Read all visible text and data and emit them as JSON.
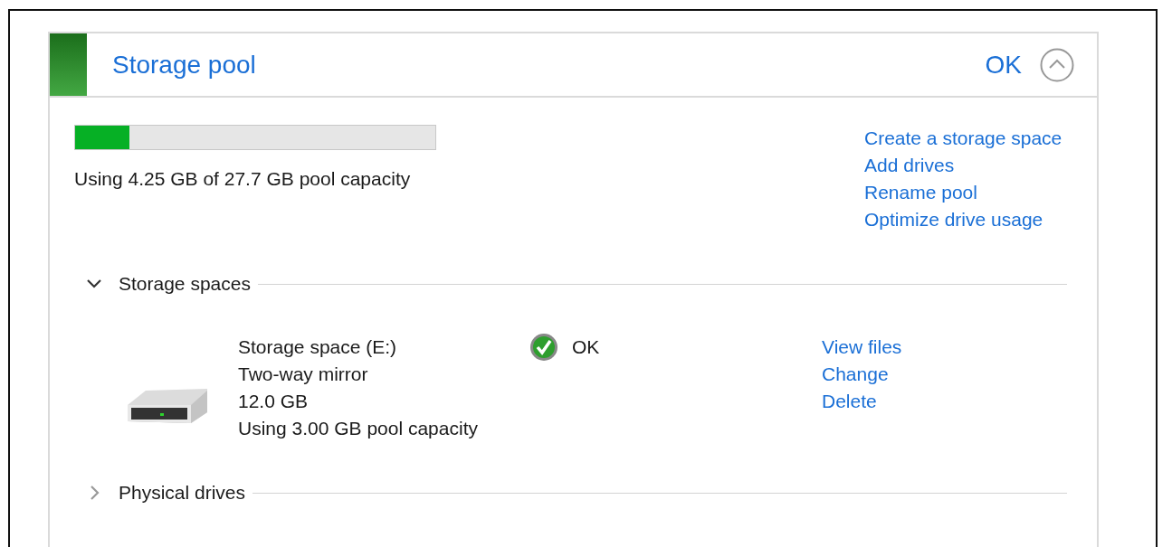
{
  "pool": {
    "title": "Storage pool",
    "status": "OK",
    "expanded": true,
    "usage": {
      "level": 0.15,
      "text": "Using 4.25 GB of 27.7 GB pool capacity"
    },
    "actions": [
      "Create a storage space",
      "Add drives",
      "Rename pool",
      "Optimize drive usage"
    ]
  },
  "sections": [
    {
      "title": "Storage spaces",
      "expanded": true,
      "items": [
        {
          "name": "Storage space (E:)",
          "details": [
            "Two-way mirror",
            "12.0 GB",
            "Using 3.00 GB pool capacity"
          ],
          "status": "OK",
          "actions": [
            "View files",
            "Change",
            "Delete"
          ]
        }
      ]
    },
    {
      "title": "Physical drives",
      "expanded": false
    }
  ]
}
